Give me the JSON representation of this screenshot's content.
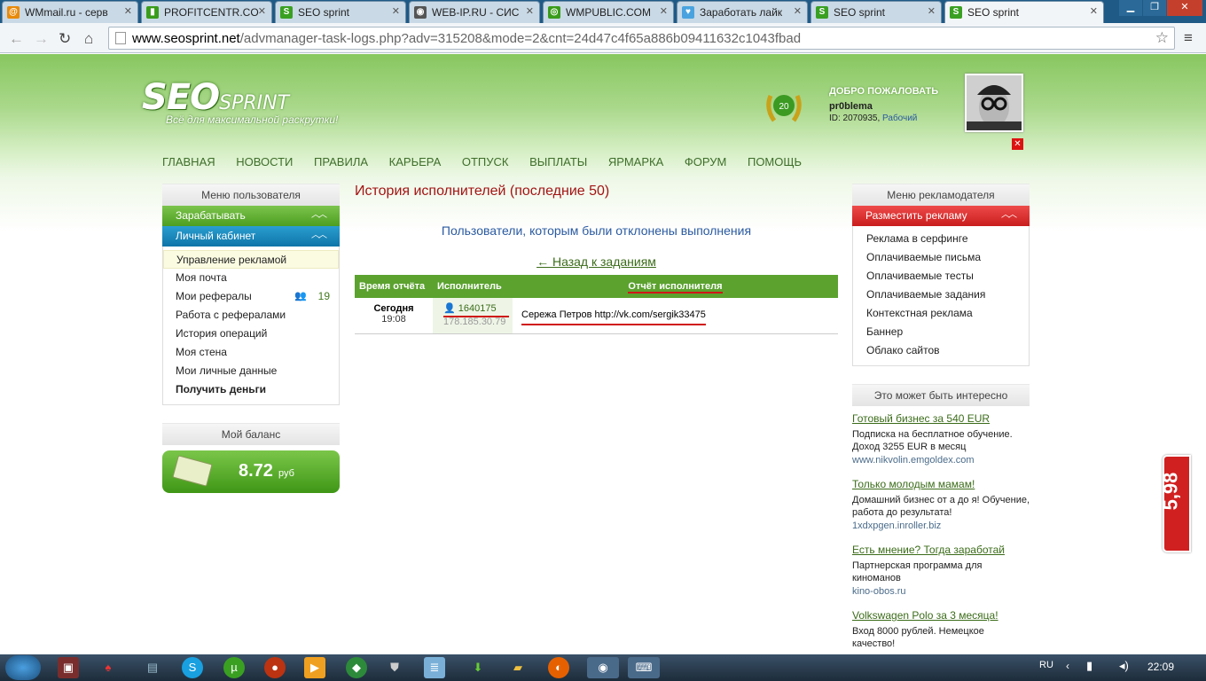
{
  "browser": {
    "tabs": [
      {
        "label": "WMmail.ru - серв",
        "icon": "mail-icon",
        "color": "#e88a0a",
        "glyph": "@"
      },
      {
        "label": "PROFITCENTR.CO",
        "icon": "chart-icon",
        "color": "#3a9c1a",
        "glyph": "▮"
      },
      {
        "label": "SEO sprint",
        "icon": "seosprint-icon",
        "color": "#3aa022",
        "glyph": "S"
      },
      {
        "label": "WEB-IP.RU - СИС",
        "icon": "webip-icon",
        "color": "#555555",
        "glyph": "◉"
      },
      {
        "label": "WMPUBLIC.COM",
        "icon": "wmpublic-icon",
        "color": "#3a9c1a",
        "glyph": "◎"
      },
      {
        "label": "Заработать лайк",
        "icon": "heart-icon",
        "color": "#4aa3df",
        "glyph": "♥"
      },
      {
        "label": "SEO sprint",
        "icon": "seosprint-icon",
        "color": "#3aa022",
        "glyph": "S"
      },
      {
        "label": "SEO sprint",
        "icon": "seosprint-icon",
        "color": "#3aa022",
        "glyph": "S"
      }
    ],
    "url_host": "www.seosprint.net",
    "url_rest": "/advmanager-task-logs.php?adv=315208&mode=2&cnt=24d47c4f65a886b09411632c1043fbad"
  },
  "header": {
    "logo_seo": "SEO",
    "logo_sprint": "SPRINT",
    "slogan": "Всё для максимальной раскрутки!",
    "level": "20",
    "welcome": "ДОБРО ПОЖАЛОВАТЬ",
    "username": "pr0blema",
    "user_id": "ID: 2070935,",
    "status": "Рабочий"
  },
  "nav": [
    "ГЛАВНАЯ",
    "НОВОСТИ",
    "ПРАВИЛА",
    "КАРЬЕРА",
    "ОТПУСК",
    "ВЫПЛАТЫ",
    "ЯРМАРКА",
    "ФОРУМ",
    "ПОМОЩЬ"
  ],
  "left": {
    "menu_title": "Меню пользователя",
    "earn": "Зарабатывать",
    "cabinet": "Личный кабинет",
    "items": [
      "Управление рекламой",
      "Моя почта",
      "Мои рефералы",
      "Работа с рефералами",
      "История операций",
      "Моя стена",
      "Мои личные данные",
      "Получить деньги"
    ],
    "ref_count": "19",
    "balance_title": "Мой баланс",
    "balance": "8.72",
    "currency": "руб"
  },
  "main": {
    "title": "История исполнителей (последние 50)",
    "subtitle": "Пользователи, которым были отклонены выполнения",
    "back": "← Назад к заданиям",
    "columns": [
      "Время отчёта",
      "Исполнитель",
      "Отчёт исполнителя"
    ],
    "rows": [
      {
        "day": "Сегодня",
        "time": "19:08",
        "user_id": "1640175",
        "ip": "178.185.30.79",
        "report": "Сережа Петров http://vk.com/sergik33475"
      }
    ]
  },
  "right": {
    "menu_title": "Меню рекламодателя",
    "place_ad": "Разместить рекламу",
    "items": [
      "Реклама в серфинге",
      "Оплачиваемые письма",
      "Оплачиваемые тесты",
      "Оплачиваемые задания",
      "Контекстная реклама",
      "Баннер",
      "Облако сайтов"
    ],
    "interest_title": "Это может быть интересно",
    "ads": [
      {
        "title": "Готовый бизнес за 540 EUR",
        "desc": "Подписка на бесплатное обучение. Доход 3255 EUR в месяц",
        "url": "www.nikvolin.emgoldex.com"
      },
      {
        "title": "Только молодым мамам!",
        "desc": "Домашний бизнес от а до я! Обучение, работа до результата!",
        "url": "1xdxpgen.inroller.biz"
      },
      {
        "title": "Есть мнение? Тогда заработай",
        "desc": "Партнерская программа для киноманов",
        "url": "kino-obos.ru"
      },
      {
        "title": "Volkswagen Polo за 3 месяца!",
        "desc": "Вход 8000 рублей. Немецкое качество!",
        "url": ""
      }
    ]
  },
  "side_badge": "5,98",
  "taskbar": {
    "lang": "RU",
    "time": "22:09"
  }
}
